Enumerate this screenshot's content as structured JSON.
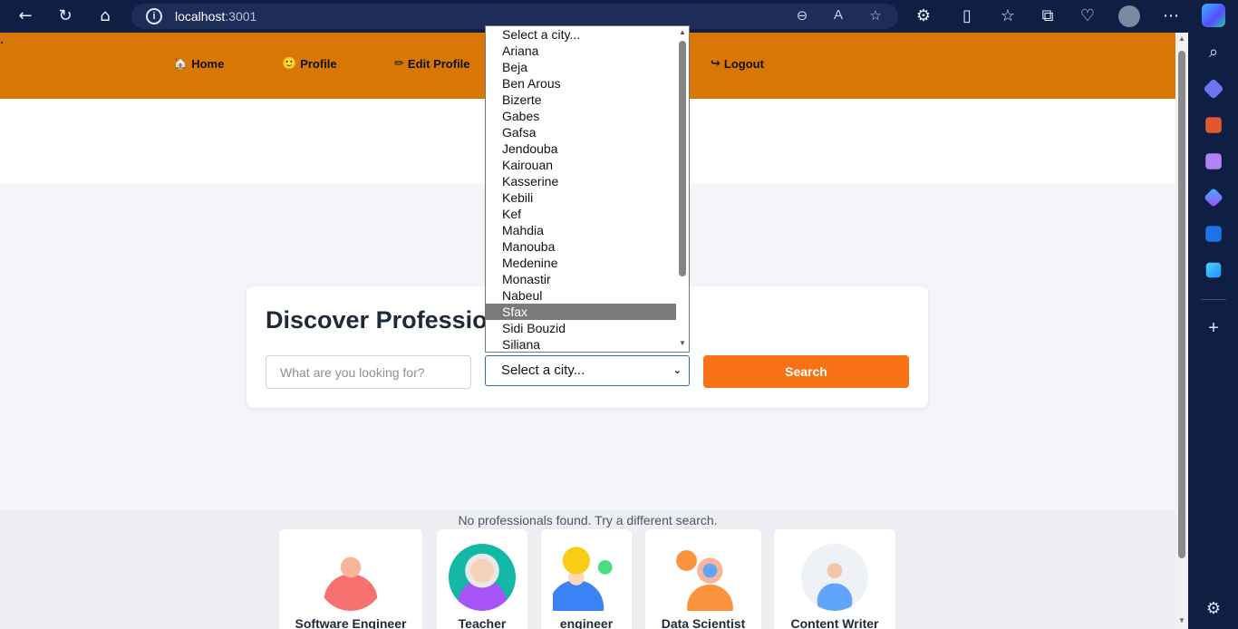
{
  "browser": {
    "url_host": "localhost",
    "url_port": ":3001",
    "nav_icons": [
      "back-icon",
      "refresh-icon",
      "home-icon"
    ],
    "address_icons": [
      "zoom-out-icon",
      "read-aloud-icon",
      "favorite-star-icon"
    ],
    "toolbar_icons": [
      "extensions-icon",
      "split-screen-icon",
      "favorites-icon",
      "collections-icon",
      "browser-essentials-icon",
      "profile-avatar",
      "more-icon",
      "copilot-icon"
    ],
    "sidebar_icons": [
      "search-icon",
      "shopping-tag-icon",
      "tools-icon",
      "games-icon",
      "copilot-app-icon",
      "outlook-icon",
      "send-icon",
      "add-icon",
      "settings-icon"
    ]
  },
  "navbar": {
    "items": [
      {
        "icon": "🏠",
        "label": "Home"
      },
      {
        "icon": "🙂",
        "label": "Profile"
      },
      {
        "icon": "✏",
        "label": "Edit Profile"
      },
      {
        "icon": "↪",
        "label": "Logout"
      }
    ]
  },
  "search_card": {
    "title": "Discover Professio",
    "search_placeholder": "What are you looking for?",
    "city_selected": "Select a city...",
    "search_button": "Search"
  },
  "city_dropdown": {
    "options": [
      "Select a city...",
      "Ariana",
      "Beja",
      "Ben Arous",
      "Bizerte",
      "Gabes",
      "Gafsa",
      "Jendouba",
      "Kairouan",
      "Kasserine",
      "Kebili",
      "Kef",
      "Mahdia",
      "Manouba",
      "Medenine",
      "Monastir",
      "Nabeul",
      "Sfax",
      "Sidi Bouzid",
      "Siliana"
    ],
    "highlighted": "Sfax"
  },
  "results": {
    "empty_message": "No professionals found. Try a different search.",
    "categories": [
      {
        "label": "Software Engineer",
        "color": "#f87171"
      },
      {
        "label": "Teacher",
        "color": "#14b8a6"
      },
      {
        "label": "engineer",
        "color": "#facc15"
      },
      {
        "label": "Data Scientist",
        "color": "#fb923c"
      },
      {
        "label": "Content Writer",
        "color": "#60a5fa"
      }
    ]
  }
}
